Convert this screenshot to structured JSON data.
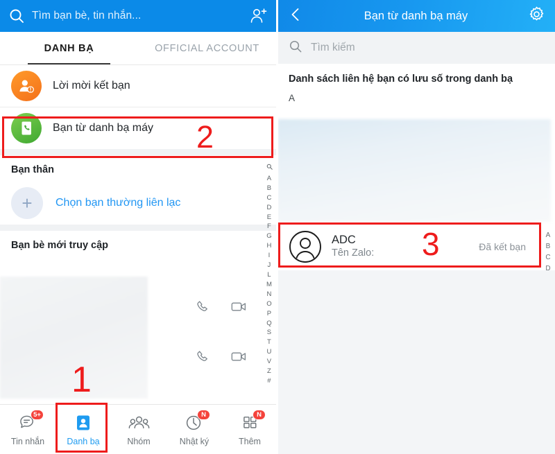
{
  "left": {
    "header": {
      "search_placeholder": "Tìm bạn bè, tin nhắn...",
      "search_icon": "search-icon",
      "add_friend_icon": "add-user-icon"
    },
    "tabs": [
      {
        "label": "DANH BẠ",
        "active": true
      },
      {
        "label": "OFFICIAL ACCOUNT",
        "active": false
      }
    ],
    "menu": [
      {
        "label": "Lời mời kết bạn",
        "icon": "friend-request-icon",
        "color": "#f4701a"
      },
      {
        "label": "Bạn từ danh bạ máy",
        "icon": "phonebook-icon",
        "color": "#3fa832"
      }
    ],
    "favorites": {
      "title": "Bạn thân",
      "add_label": "Chọn bạn thường liên lạc",
      "add_icon": "plus-icon"
    },
    "recent": {
      "title": "Bạn bè mới truy cập",
      "row_icons": [
        "phone-call-icon",
        "video-call-icon"
      ]
    },
    "alpha_index": [
      "A",
      "B",
      "C",
      "D",
      "E",
      "F",
      "G",
      "H",
      "I",
      "J",
      "L",
      "M",
      "N",
      "O",
      "P",
      "Q",
      "S",
      "T",
      "U",
      "V",
      "Z",
      "#"
    ],
    "alpha_index_search_icon": "search-icon",
    "bottom_nav": [
      {
        "label": "Tin nhắn",
        "icon": "message-icon",
        "badge": "5+",
        "active": false
      },
      {
        "label": "Danh bạ",
        "icon": "contacts-icon",
        "badge": "",
        "active": true
      },
      {
        "label": "Nhóm",
        "icon": "group-icon",
        "badge": "",
        "active": false
      },
      {
        "label": "Nhật ký",
        "icon": "clock-icon",
        "badge": "N",
        "active": false
      },
      {
        "label": "Thêm",
        "icon": "grid-icon",
        "badge": "N",
        "active": false
      }
    ]
  },
  "right": {
    "header": {
      "title": "Bạn từ danh bạ máy",
      "back_icon": "back-chevron-icon",
      "settings_icon": "gear-icon"
    },
    "search": {
      "placeholder": "Tìm kiếm",
      "icon": "search-icon"
    },
    "list_header": "Danh sách liên hệ bạn có lưu số trong danh bạ",
    "section_letter": "A",
    "contacts": [
      {
        "name": "ADC",
        "subtitle": "Tên Zalo:",
        "status": "Đã kết bạn",
        "avatar_icon": "person-avatar-icon"
      }
    ],
    "alpha_index": [
      "A",
      "B",
      "C",
      "D"
    ]
  },
  "annotations": [
    {
      "number": "1",
      "target": "danh-ba-tab"
    },
    {
      "number": "2",
      "target": "ban-tu-danh-ba-may-row"
    },
    {
      "number": "3",
      "target": "adc-contact-row"
    }
  ],
  "colors": {
    "header_blue": "#0b8ae8",
    "accent_blue": "#2196f3",
    "annotation_red": "#ee1c1c",
    "badge_red": "#f4433c",
    "orange": "#f4701a",
    "green": "#3fa832"
  }
}
